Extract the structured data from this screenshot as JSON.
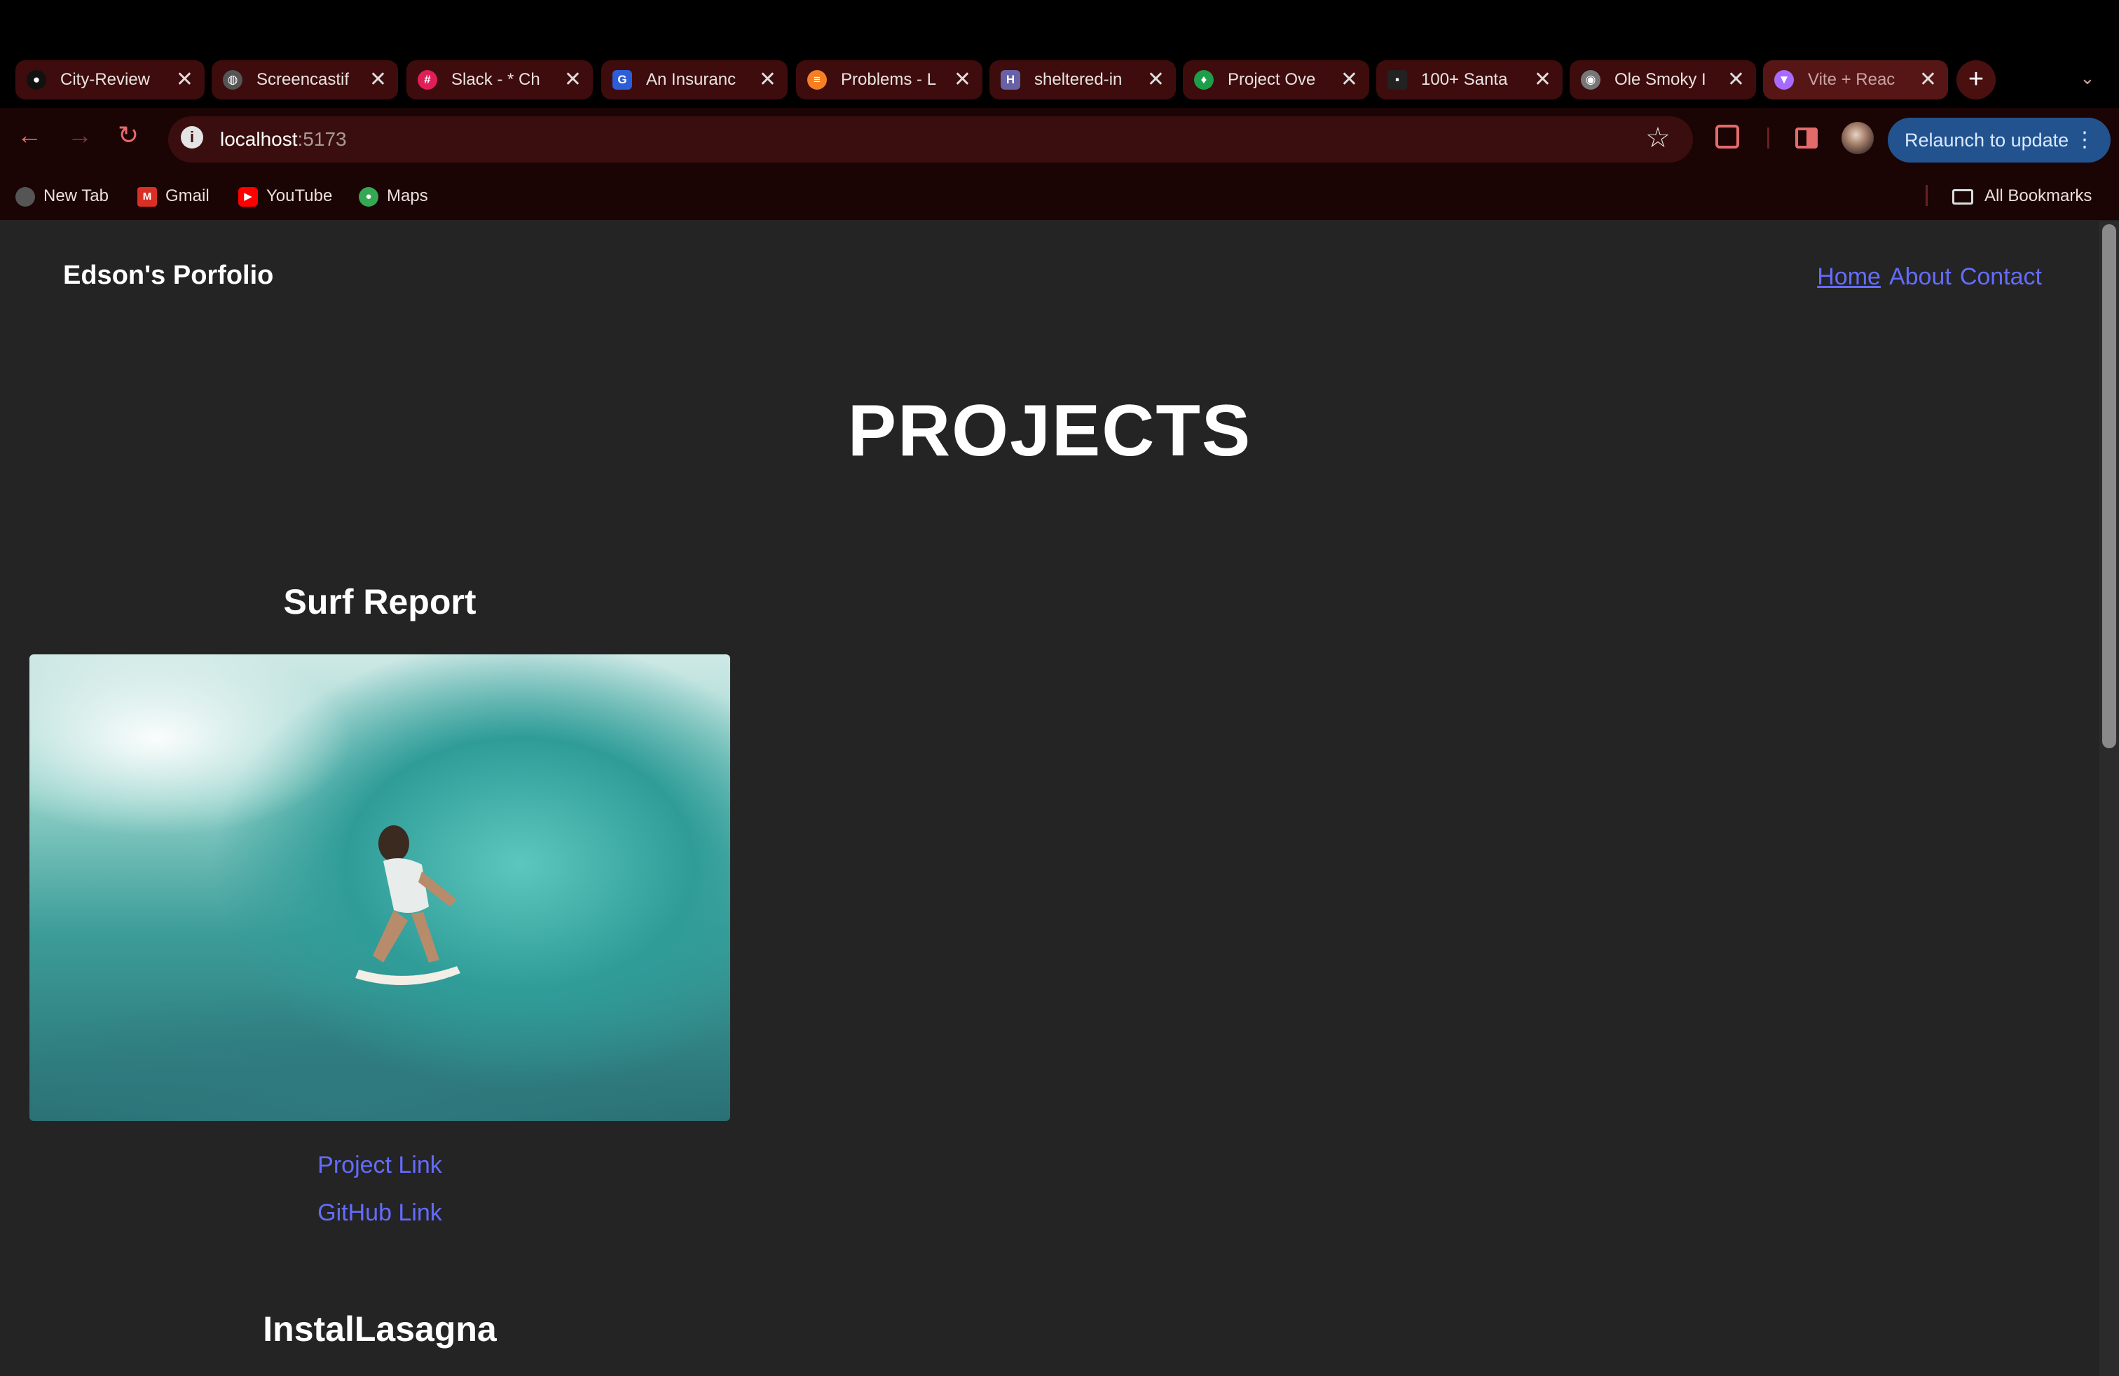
{
  "browser": {
    "tabs": [
      {
        "title": "City-Review",
        "icon": "github-icon",
        "color": "#111111"
      },
      {
        "title": "Screencastif",
        "icon": "globe-icon",
        "color": "#555555"
      },
      {
        "title": "Slack - * Ch",
        "icon": "slack-icon",
        "color": "#e01e5a"
      },
      {
        "title": "An Insuranc",
        "icon": "g-app-icon",
        "color": "#2e5ed7"
      },
      {
        "title": "Problems - L",
        "icon": "stack-icon",
        "color": "#f48024"
      },
      {
        "title": "sheltered-in",
        "icon": "heroku-icon",
        "color": "#6762a6"
      },
      {
        "title": "Project Ove",
        "icon": "leaf-icon",
        "color": "#1e9e4a"
      },
      {
        "title": "100+ Santa",
        "icon": "unsplash-icon",
        "color": "#222222"
      },
      {
        "title": "Ole Smoky I",
        "icon": "ole-smoky-icon",
        "color": "#777777"
      },
      {
        "title": "Vite + Reac",
        "icon": "vite-icon",
        "color": "#a86bff",
        "active": true
      }
    ],
    "tab_close_glyph": "✕",
    "new_tab_glyph": "+",
    "tab_search_glyph": "⌄",
    "nav": {
      "back": "←",
      "forward": "→",
      "reload": "↻"
    },
    "url_host": "localhost",
    "url_port": ":5173",
    "info_glyph": "i",
    "star_glyph": "☆",
    "relaunch_label": "Relaunch to update",
    "menu_glyph": "⋮",
    "bookmarks": [
      {
        "label": "New Tab",
        "icon": "globe-icon",
        "color": "#555555",
        "glyph": ""
      },
      {
        "label": "Gmail",
        "icon": "gmail-icon",
        "color": "#d93025",
        "glyph": "M"
      },
      {
        "label": "YouTube",
        "icon": "youtube-icon",
        "color": "#ff0000",
        "glyph": "▶"
      },
      {
        "label": "Maps",
        "icon": "maps-icon",
        "color": "#34a853",
        "glyph": "●"
      }
    ],
    "all_bookmarks": "All Bookmarks"
  },
  "site": {
    "brand": "Edson's Porfolio",
    "nav": [
      "Home",
      "About",
      "Contact"
    ],
    "heading": "PROJECTS",
    "projects": [
      {
        "title": "Surf Report",
        "project_link": "Project Link",
        "github_link": "GitHub Link"
      },
      {
        "title": "InstalLasagna"
      }
    ]
  },
  "colors": {
    "page_bg": "#242424",
    "link": "#646cff",
    "chrome_bg": "#1b0404",
    "relaunch_bg": "#22538f"
  }
}
